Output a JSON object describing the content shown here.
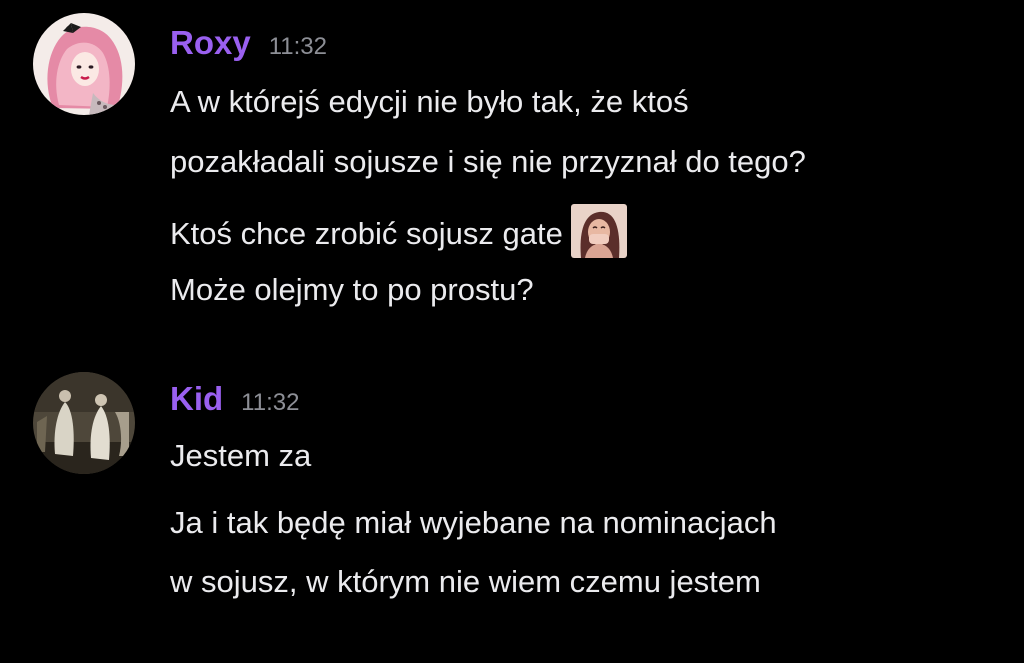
{
  "messages": [
    {
      "username": "Roxy",
      "timestamp": "11:32",
      "avatar_icon": "pink-hair-doll-avatar",
      "lines": [
        "A w którejś edycji nie było tak, że ktoś",
        "pozakładali sojusze i się nie przyznał do tego?",
        "Ktoś chce zrobić sojusz gate",
        "Może olejmy to po prostu?"
      ],
      "inline_emoji": "crying-woman-emoji"
    },
    {
      "username": "Kid",
      "timestamp": "11:32",
      "avatar_icon": "blurry-figures-avatar",
      "lines": [
        "Jestem za",
        "Ja i tak będę miał wyjebane na nominacjach",
        "w sojusz, w którym nie wiem czemu jestem"
      ]
    }
  ],
  "colors": {
    "background": "#000000",
    "username": "#9a60f0",
    "timestamp": "#8d8f96",
    "text": "#ebebee"
  }
}
